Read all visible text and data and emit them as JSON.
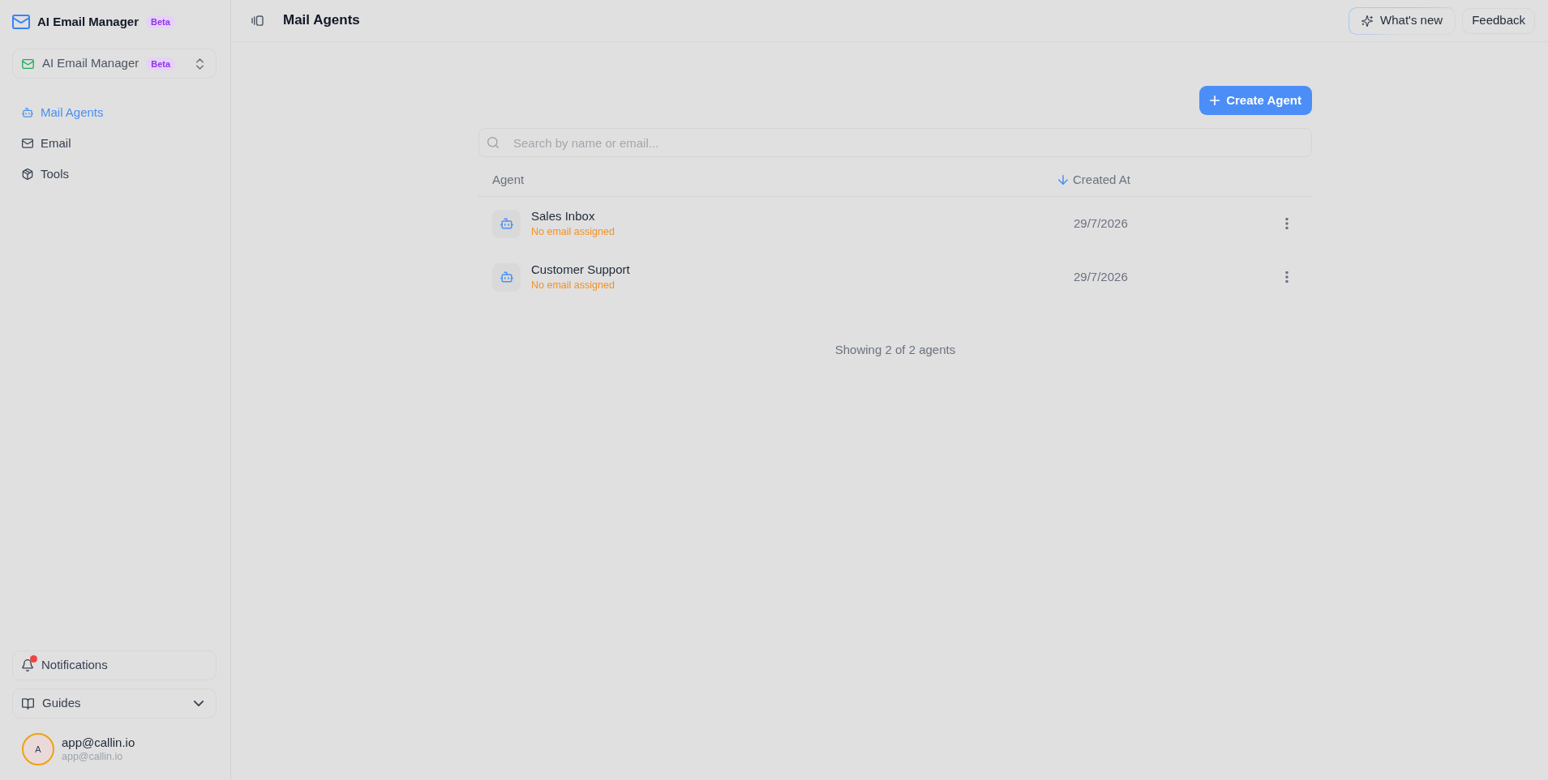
{
  "sidebar": {
    "brand": {
      "title": "AI Email Manager",
      "badge": "Beta"
    },
    "workspace": {
      "name": "AI Email Manager",
      "badge": "Beta"
    },
    "nav": [
      {
        "label": "Mail Agents",
        "selected": true
      },
      {
        "label": "Email",
        "selected": false
      },
      {
        "label": "Tools",
        "selected": false
      }
    ],
    "notifications": {
      "label": "Notifications",
      "unread": true
    },
    "guides": {
      "label": "Guides",
      "expanded": false
    },
    "user": {
      "initial": "A",
      "name": "app@callin.io",
      "email": "app@callin.io"
    }
  },
  "header": {
    "title": "Mail Agents",
    "buttons": [
      {
        "label": "What's new",
        "kind": "highlight"
      },
      {
        "label": "Feedback",
        "kind": "plain"
      }
    ]
  },
  "create_button": {
    "label": "Create Agent"
  },
  "search": {
    "placeholder": "Search by name or email..."
  },
  "table": {
    "columns": [
      {
        "label": "Agent",
        "sorted": false
      },
      {
        "label": "Created At",
        "sorted": true
      }
    ],
    "rows": [
      {
        "name": "Sales Inbox",
        "email_status": "No email assigned",
        "created_at": "29/7/2026"
      },
      {
        "name": "Customer Support",
        "email_status": "No email assigned",
        "created_at": "29/7/2026"
      }
    ]
  },
  "summary": "Showing 2 of 2 agents"
}
